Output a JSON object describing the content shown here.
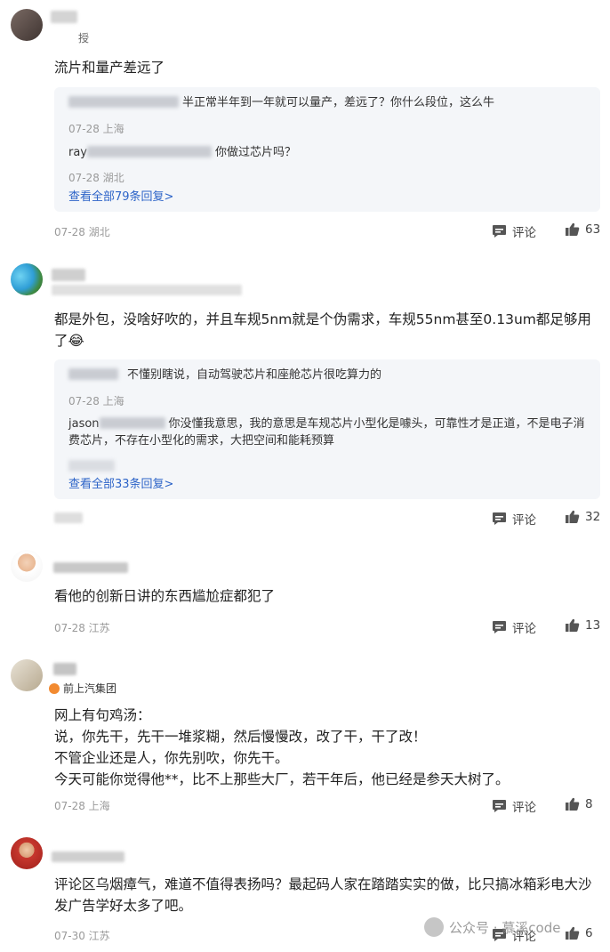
{
  "comments": [
    {
      "name_suffix": "授",
      "text": "流片和量产差远了",
      "replies": [
        {
          "text": "半正常半年到一年就可以量产，差远了？你什么段位，这么牛",
          "meta": "07-28 上海"
        },
        {
          "name_prefix": "ray",
          "text": "你做过芯片吗？",
          "meta": "07-28 湖北"
        }
      ],
      "view_all": "查看全部79条回复>",
      "meta": "07-28 湖北",
      "comment_label": "评论",
      "likes": "63"
    },
    {
      "text": "都是外包，没啥好吹的，并且车规5nm就是个伪需求，车规55nm甚至0.13um都足够用了😂",
      "replies": [
        {
          "text": "不懂别瞎说，自动驾驶芯片和座舱芯片很吃算力的",
          "meta": "07-28 上海"
        },
        {
          "name_prefix": "jason",
          "text": "你没懂我意思，我的意思是车规芯片小型化是噱头，可靠性才是正道，不是电子消费芯片，不存在小型化的需求，大把空间和能耗预算"
        }
      ],
      "view_all": "查看全部33条回复>",
      "comment_label": "评论",
      "likes": "32"
    },
    {
      "text": "看他的创新日讲的东西尴尬症都犯了",
      "meta": "07-28 江苏",
      "comment_label": "评论",
      "likes": "13"
    },
    {
      "org": "前上汽集团",
      "text": "网上有句鸡汤：\n说，你先干，先干一堆浆糊，然后慢慢改，改了干，干了改！\n不管企业还是人，你先别吹，你先干。\n今天可能你觉得他**，比不上那些大厂，若干年后，他已经是参天大树了。",
      "meta": "07-28 上海",
      "comment_label": "评论",
      "likes": "8"
    },
    {
      "text": "评论区乌烟瘴气，难道不值得表扬吗？最起码人家在踏踏实实的做，比只搞冰箱彩电大沙发广告学好太多了吧。",
      "meta": "07-30 江苏",
      "comment_label": "评论",
      "likes": "6"
    }
  ],
  "watermark": "公众号 · 慕溪code",
  "icons": {
    "comment": "comment-icon",
    "like": "thumbs-up-icon"
  },
  "colors": {
    "link": "#2d64c8",
    "meta": "#9a9a9a",
    "reply_bg": "#f4f6f9"
  }
}
